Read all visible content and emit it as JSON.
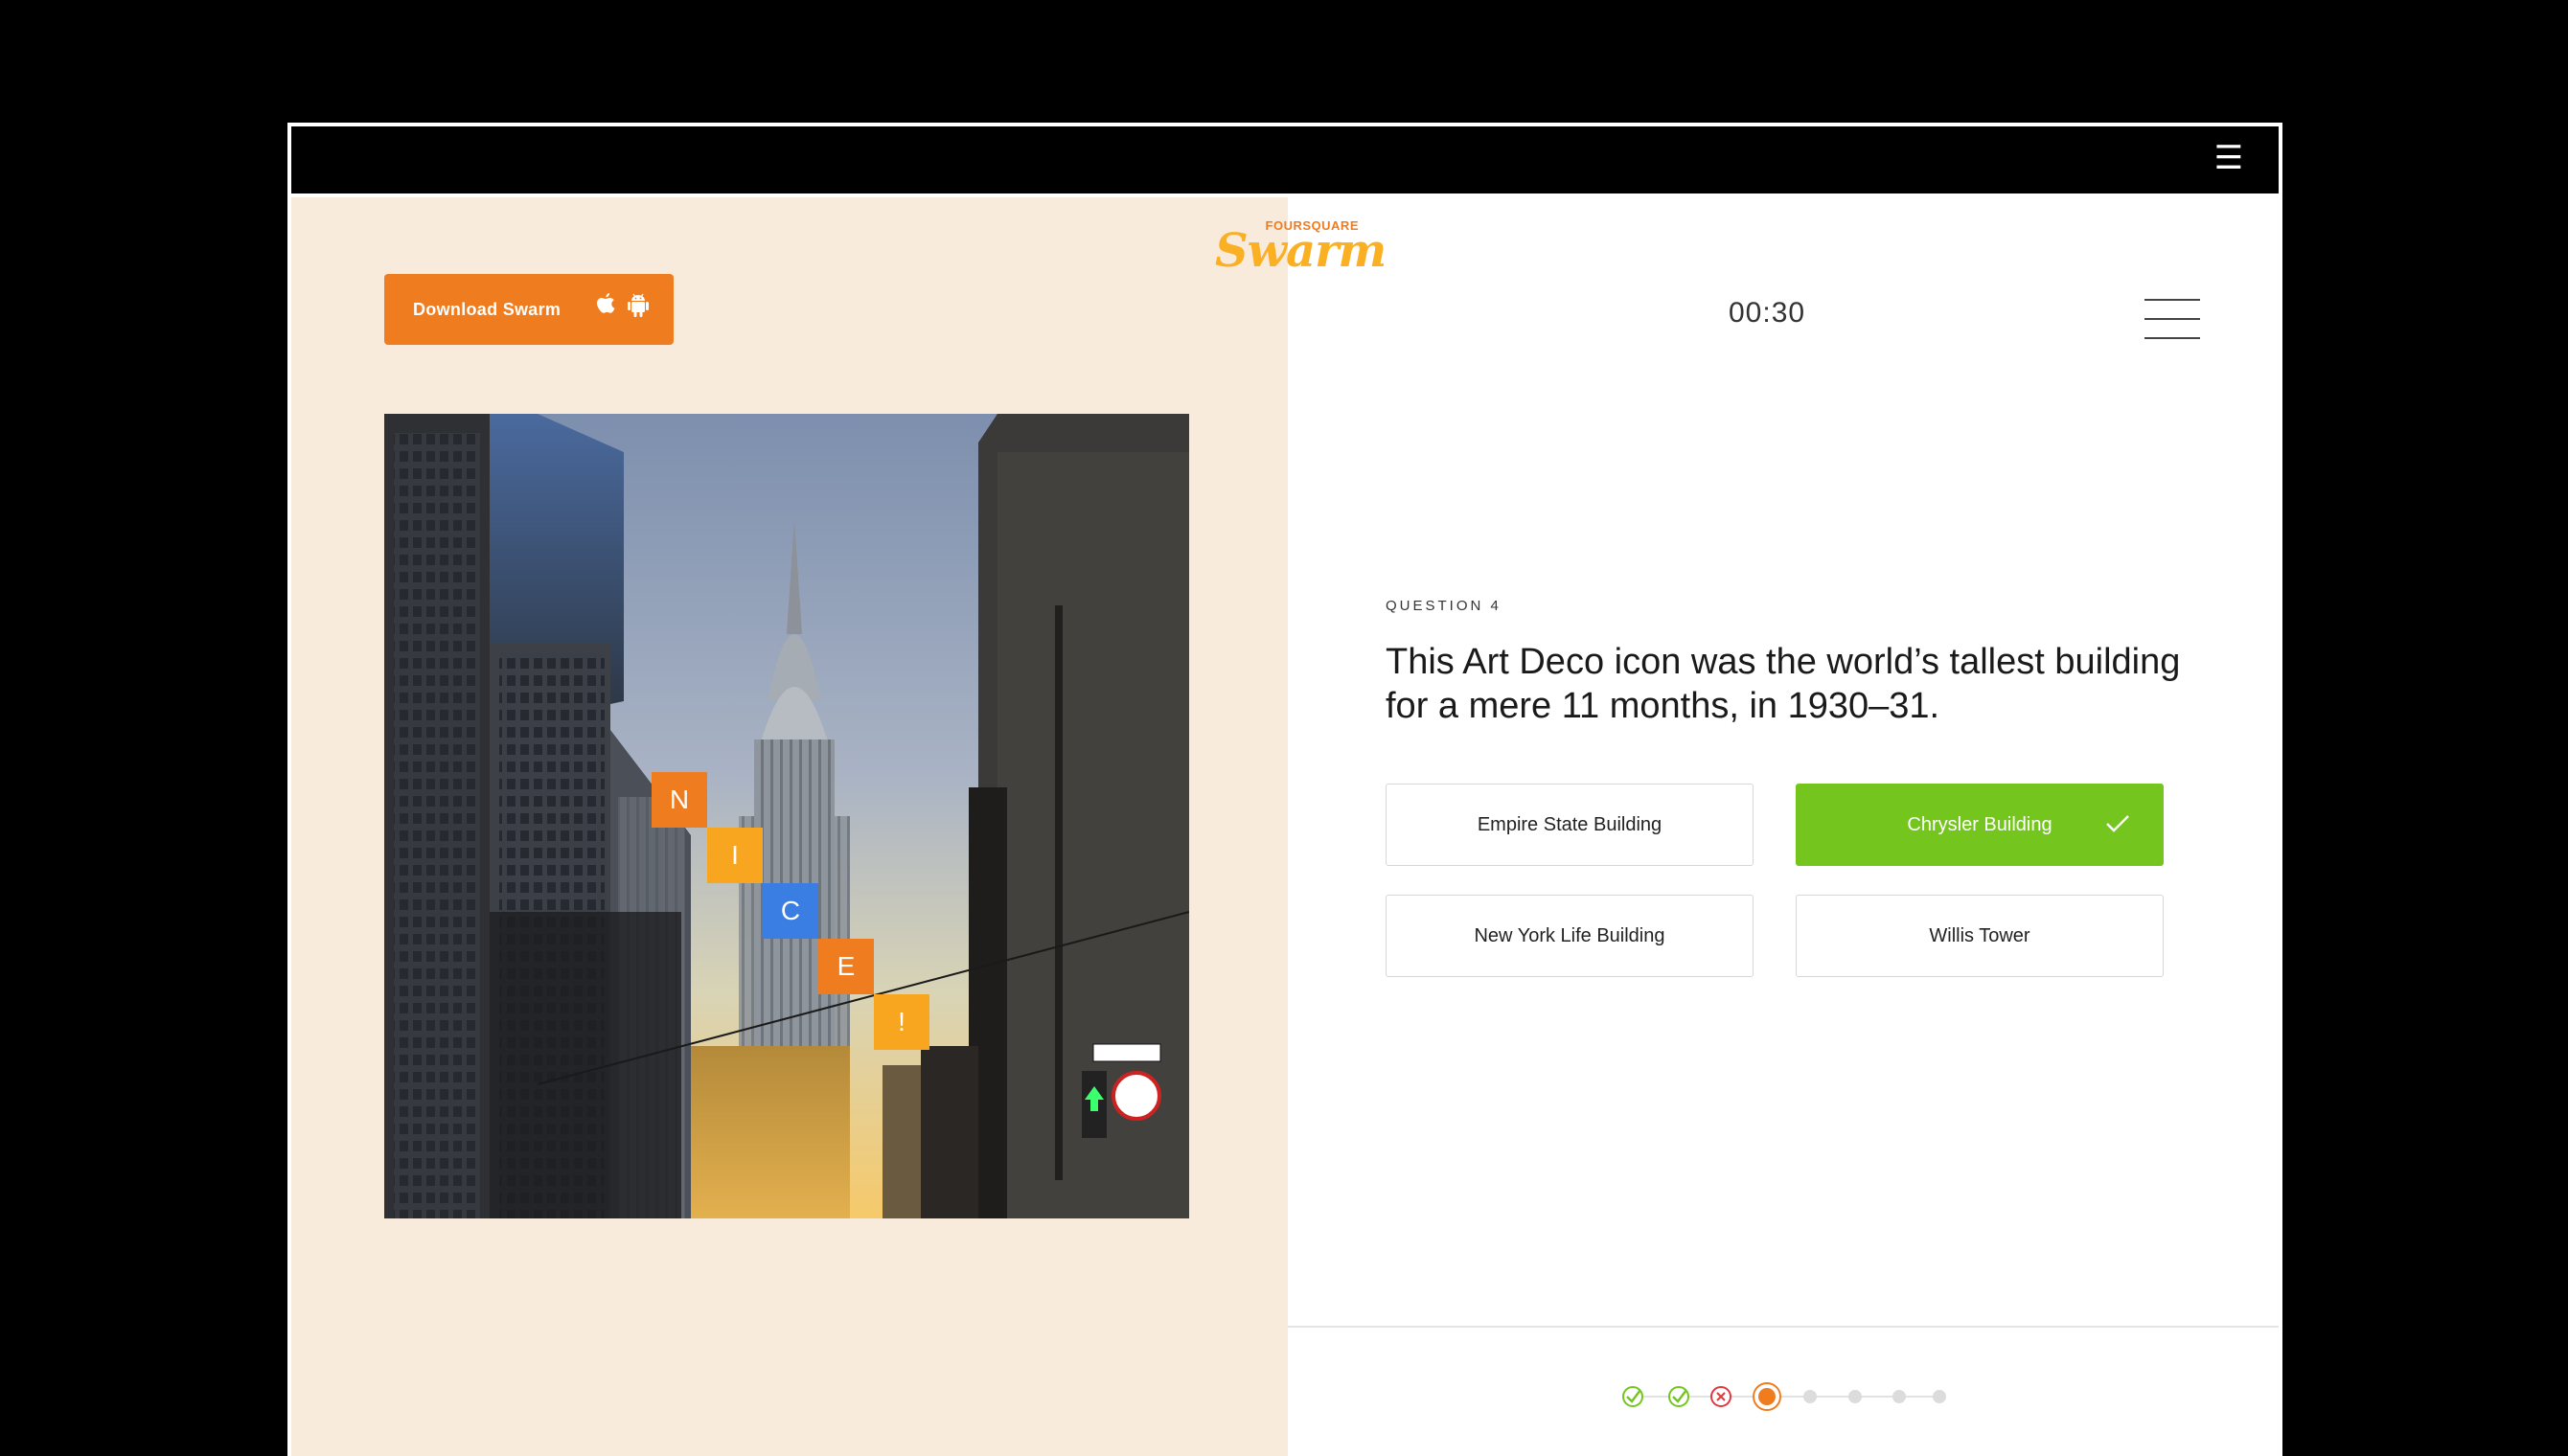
{
  "topbar": {
    "menu_glyph": "☰"
  },
  "download": {
    "label": "Download Swarm",
    "icons": [
      "apple-icon",
      "android-icon"
    ]
  },
  "logo": {
    "small": "FOURSQUARE",
    "main": "Swarm"
  },
  "timer": "00:30",
  "question": {
    "number_label": "QUESTION 4",
    "text": "This Art Deco icon was the world’s tallest building for a mere 11 months, in 1930–31."
  },
  "answers": [
    {
      "label": "Empire State Building",
      "state": "default"
    },
    {
      "label": "Chrysler Building",
      "state": "correct"
    },
    {
      "label": "New York Life Building",
      "state": "default"
    },
    {
      "label": "Willis Tower",
      "state": "default"
    }
  ],
  "tiles": [
    "N",
    "I",
    "C",
    "E",
    "!"
  ],
  "progress": [
    "correct",
    "correct",
    "wrong",
    "current",
    "pending",
    "pending",
    "pending",
    "pending"
  ],
  "colors": {
    "accent": "#f07c20",
    "correct": "#74c61e",
    "wrong": "#e0383e",
    "tile_blue": "#3a7ee3",
    "tile_yellow": "#f8a51f",
    "left_bg": "#f8ebdc"
  }
}
